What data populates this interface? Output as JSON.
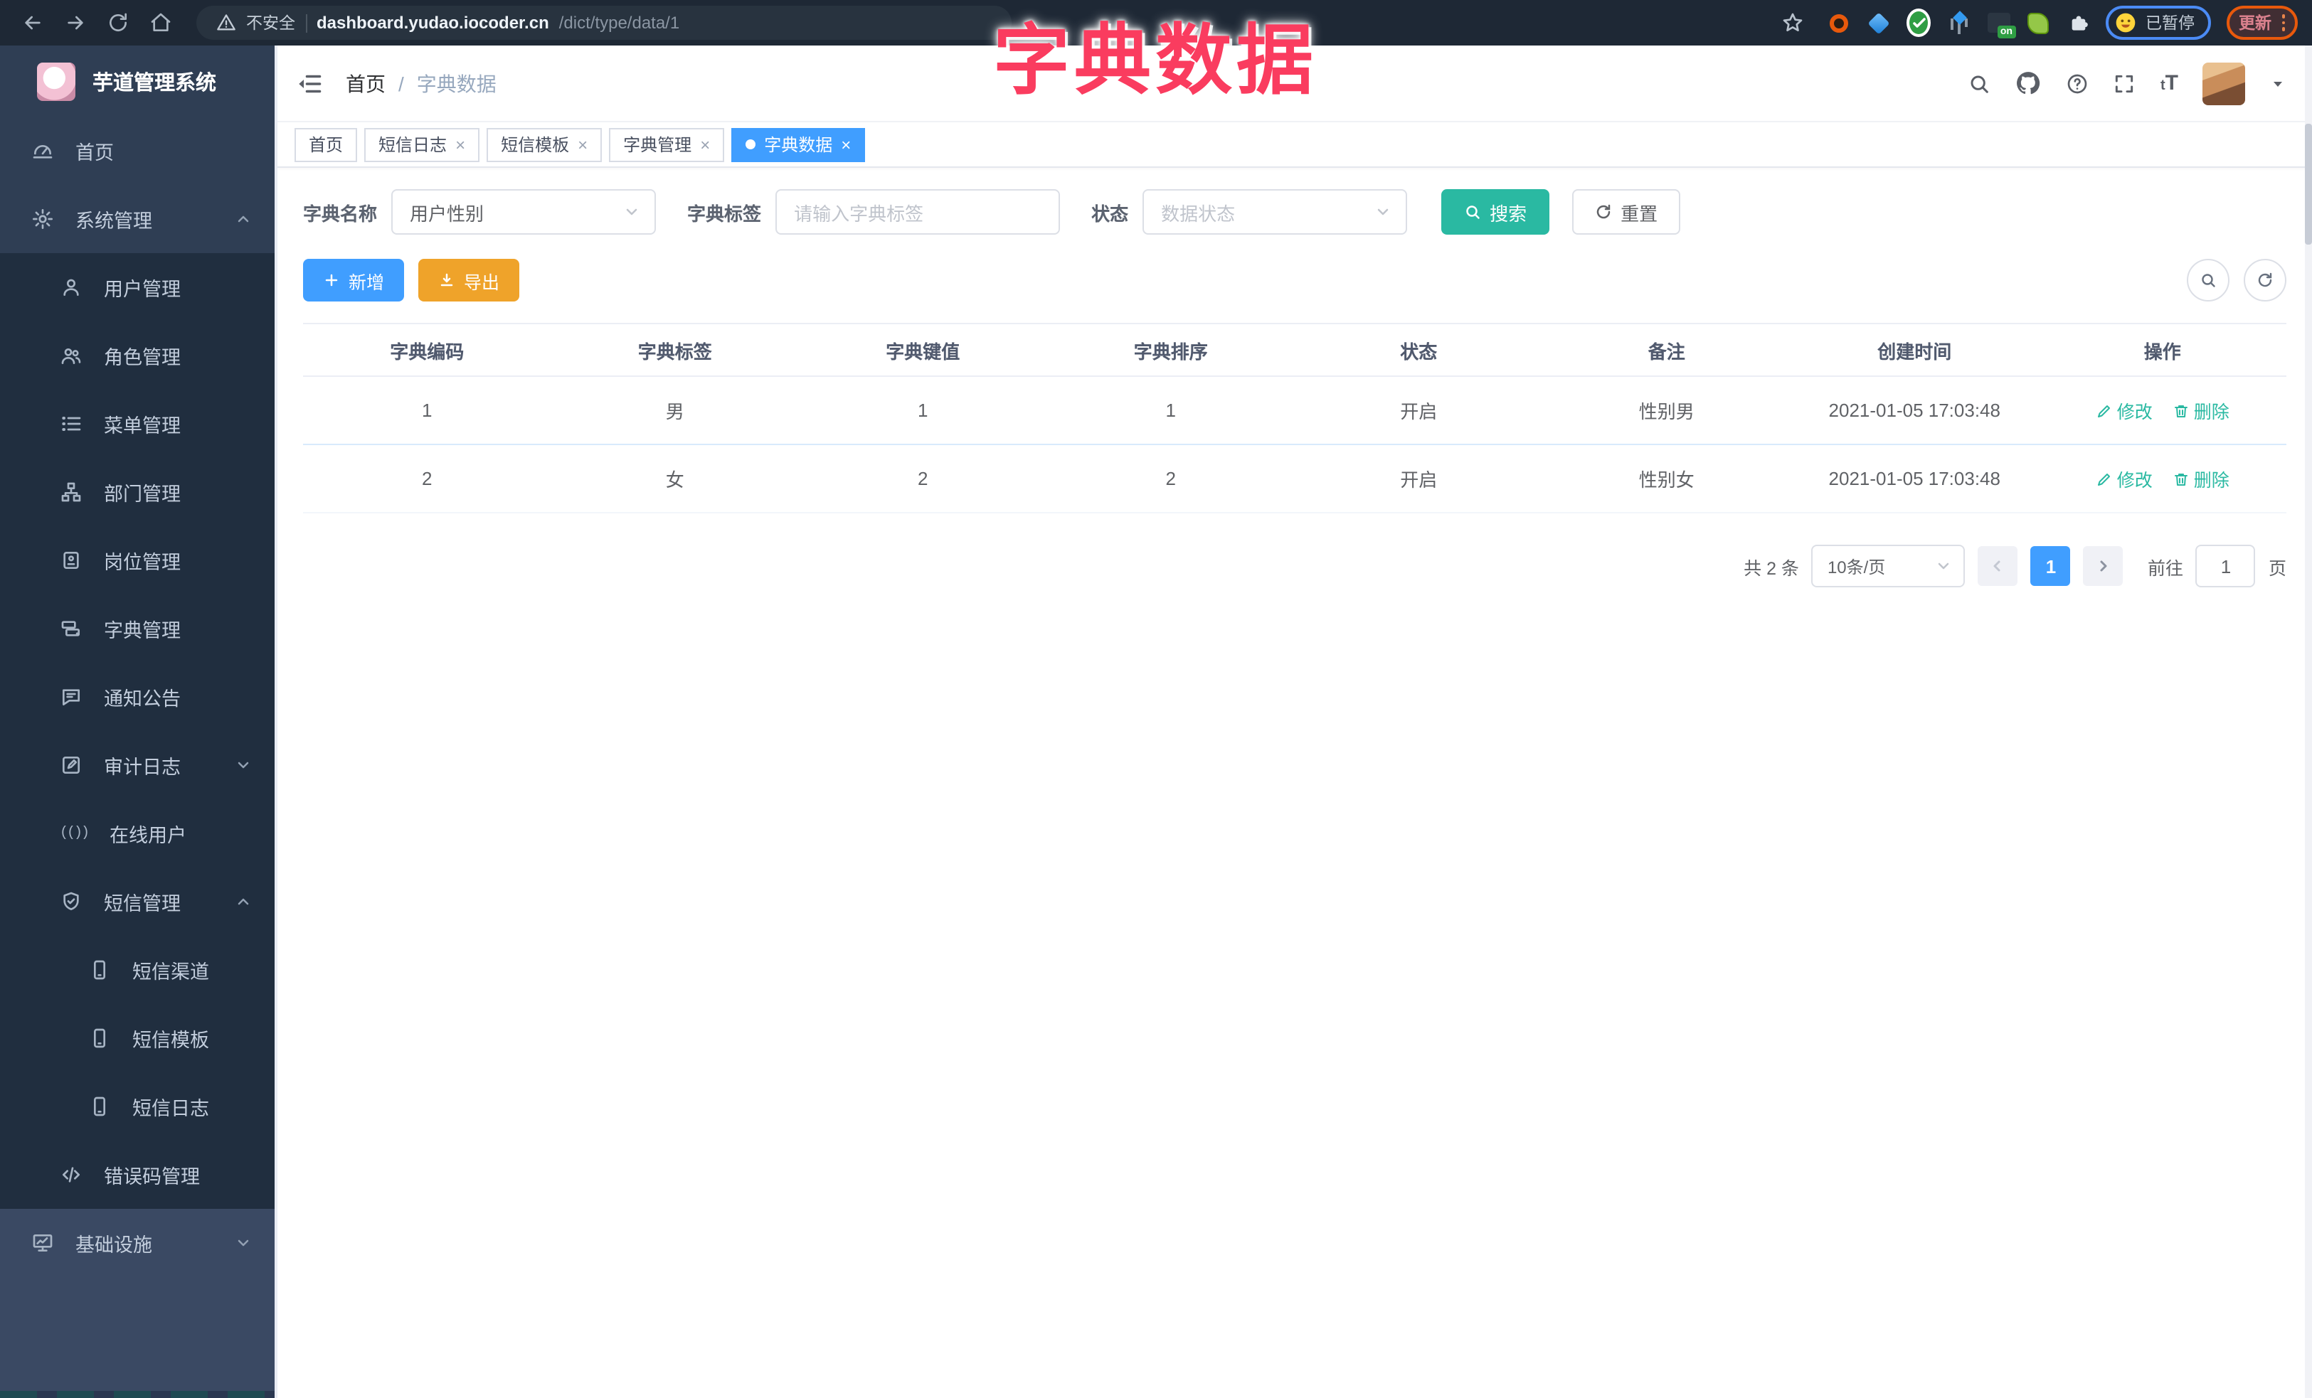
{
  "browser": {
    "security_label": "不安全",
    "url_host": "dashboard.yudao.iocoder.cn",
    "url_path": "/dict/type/data/1",
    "extension_on_badge": "on",
    "paused_label": "已暂停",
    "update_label": "更新"
  },
  "overlay": {
    "title": "字典数据"
  },
  "sidebar": {
    "app_title": "芋道管理系统",
    "items": [
      {
        "label": "首页"
      },
      {
        "label": "系统管理"
      },
      {
        "label": "用户管理"
      },
      {
        "label": "角色管理"
      },
      {
        "label": "菜单管理"
      },
      {
        "label": "部门管理"
      },
      {
        "label": "岗位管理"
      },
      {
        "label": "字典管理"
      },
      {
        "label": "通知公告"
      },
      {
        "label": "审计日志"
      },
      {
        "label": "在线用户"
      },
      {
        "label": "短信管理"
      },
      {
        "label": "短信渠道"
      },
      {
        "label": "短信模板"
      },
      {
        "label": "短信日志"
      },
      {
        "label": "错误码管理"
      },
      {
        "label": "基础设施"
      }
    ]
  },
  "header": {
    "breadcrumb_home": "首页",
    "breadcrumb_current": "字典数据"
  },
  "tabs": [
    {
      "label": "首页"
    },
    {
      "label": "短信日志"
    },
    {
      "label": "短信模板"
    },
    {
      "label": "字典管理"
    },
    {
      "label": "字典数据"
    }
  ],
  "filters": {
    "name_label": "字典名称",
    "name_value": "用户性别",
    "tag_label": "字典标签",
    "tag_placeholder": "请输入字典标签",
    "status_label": "状态",
    "status_placeholder": "数据状态",
    "search_label": "搜索",
    "reset_label": "重置"
  },
  "toolbar": {
    "add_label": "新增",
    "export_label": "导出"
  },
  "table": {
    "headers": [
      "字典编码",
      "字典标签",
      "字典键值",
      "字典排序",
      "状态",
      "备注",
      "创建时间",
      "操作"
    ],
    "rows": [
      {
        "code": "1",
        "label": "男",
        "value": "1",
        "sort": "1",
        "status": "开启",
        "remark": "性别男",
        "created": "2021-01-05 17:03:48"
      },
      {
        "code": "2",
        "label": "女",
        "value": "2",
        "sort": "2",
        "status": "开启",
        "remark": "性别女",
        "created": "2021-01-05 17:03:48"
      }
    ],
    "edit_label": "修改",
    "delete_label": "删除"
  },
  "pagination": {
    "total_label": "共 2 条",
    "page_size_label": "10条/页",
    "current_page": "1",
    "goto_label": "前往",
    "goto_value": "1",
    "page_unit_label": "页"
  },
  "colors": {
    "primary": "#409eff",
    "teal_accent": "#2ab9a2",
    "warning": "#efa32a",
    "overlay_pink": "#fa3c5f",
    "sidebar_bg": "#2f3e54",
    "submenu_bg": "#202e3f"
  }
}
